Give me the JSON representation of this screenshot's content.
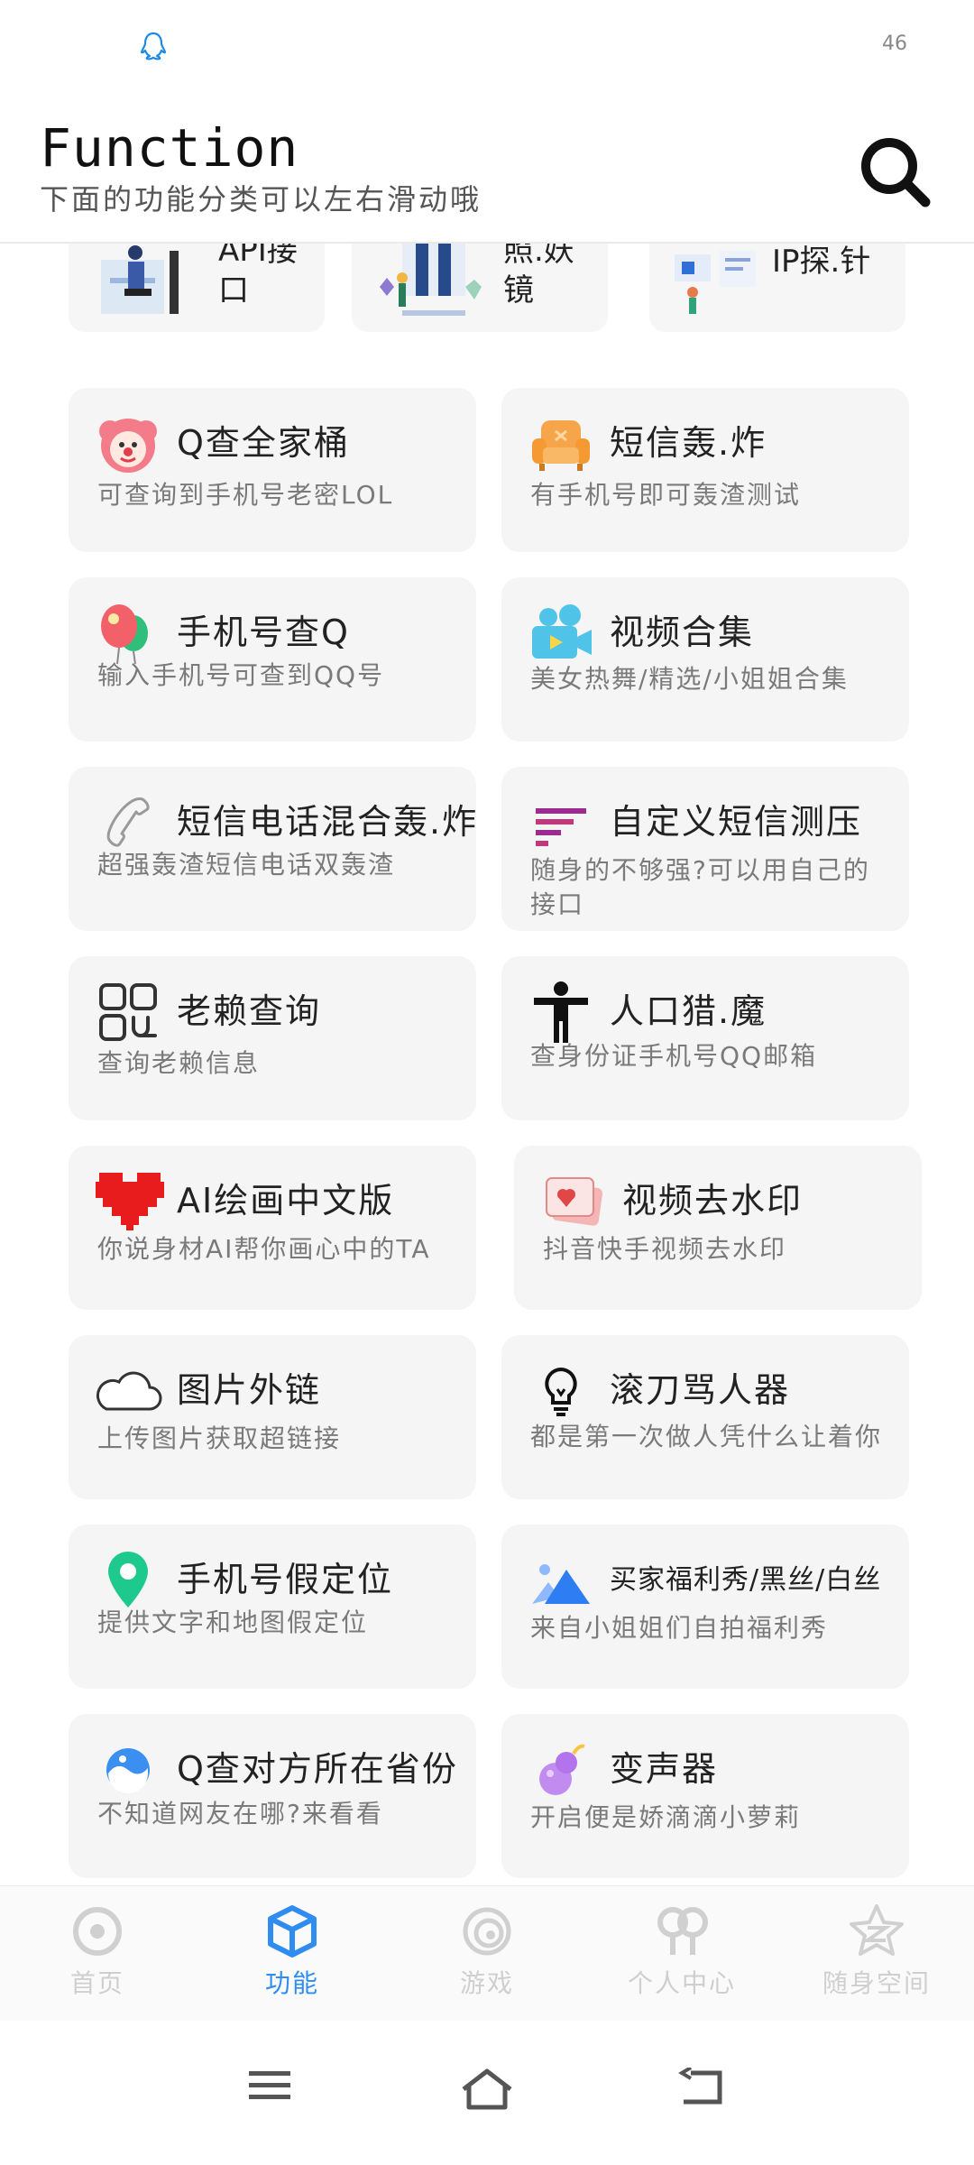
{
  "status_bar": {
    "battery": "46"
  },
  "header": {
    "title": "Function",
    "subtitle": "下面的功能分类可以左右滑动哦"
  },
  "top_cards": [
    {
      "label": "API接口"
    },
    {
      "label": "照.妖镜"
    },
    {
      "label": "IP探.针"
    }
  ],
  "cards": [
    {
      "title": "Q查全家桶",
      "desc": "可查询到手机号老密LOL"
    },
    {
      "title": "短信轰.炸",
      "desc": "有手机号即可轰渣测试"
    },
    {
      "title": "手机号查Q",
      "desc": "输入手机号可查到QQ号"
    },
    {
      "title": "视频合集",
      "desc": "美女热舞/精选/小姐姐合集"
    },
    {
      "title": "短信电话混合轰.炸",
      "desc": "超强轰渣短信电话双轰渣"
    },
    {
      "title": "自定义短信测压",
      "desc": "随身的不够强?可以用自己的接口"
    },
    {
      "title": "老赖查询",
      "desc": "查询老赖信息"
    },
    {
      "title": "人口猎.魔",
      "desc": "查身份证手机号QQ邮箱"
    },
    {
      "title": "AI绘画中文版",
      "desc": "你说身材AI帮你画心中的TA"
    },
    {
      "title": "视频去水印",
      "desc": "抖音快手视频去水印"
    },
    {
      "title": "图片外链",
      "desc": "上传图片获取超链接"
    },
    {
      "title": "滚刀骂人器",
      "desc": "都是第一次做人凭什么让着你"
    },
    {
      "title": "手机号假定位",
      "desc": "提供文字和地图假定位"
    },
    {
      "title": "买家福利秀/黑丝/白丝",
      "desc": "来自小姐姐们自拍福利秀"
    },
    {
      "title": "Q查对方所在省份",
      "desc": "不知道网友在哪?来看看"
    },
    {
      "title": "变声器",
      "desc": "开启便是娇滴滴小萝莉"
    }
  ],
  "nav": {
    "items": [
      {
        "label": "首页",
        "icon": "home-circle-icon"
      },
      {
        "label": "功能",
        "icon": "cube-icon"
      },
      {
        "label": "游戏",
        "icon": "spiral-icon"
      },
      {
        "label": "个人中心",
        "icon": "profile-icon"
      },
      {
        "label": "随身空间",
        "icon": "qzone-star-icon"
      }
    ],
    "active_color": "#2f8cf0",
    "inactive_color": "#cfcfcf"
  }
}
